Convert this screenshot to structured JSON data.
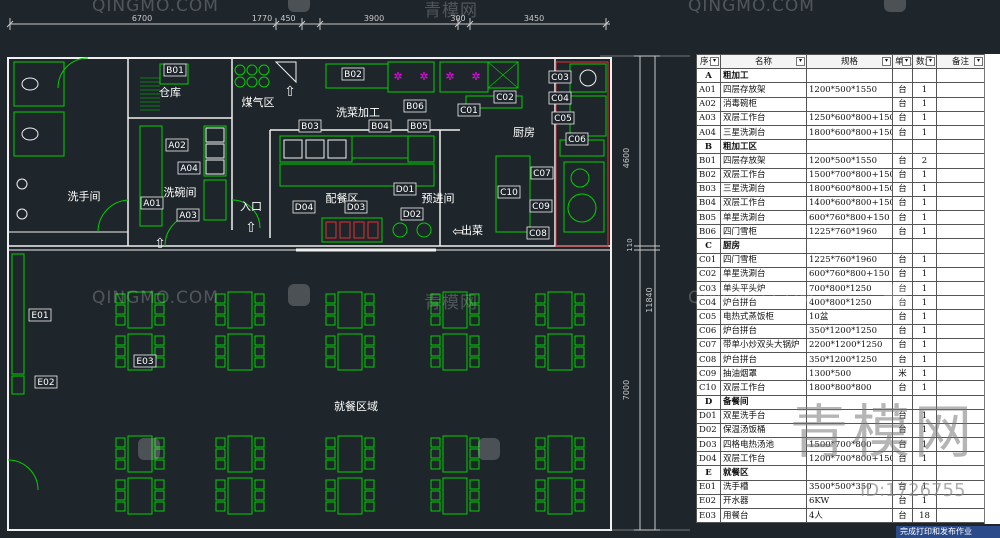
{
  "dimensions": {
    "top": [
      "6700",
      "1770",
      "450",
      "3900",
      "300",
      "3450"
    ],
    "right": [
      "4600",
      "110",
      "11840",
      "7000"
    ]
  },
  "rooms": {
    "storage": "仓库",
    "gas": "煤气区",
    "wash_veg": "洗菜加工",
    "kitchen": "厨房",
    "washroom": "洗手间",
    "dish": "洗碗间",
    "entrance": "入口",
    "serving": "配餐区",
    "pre_entry": "预进间",
    "dining": "就餐区域",
    "out": "出菜"
  },
  "tags": [
    "B01",
    "B02",
    "B03",
    "B04",
    "B05",
    "B06",
    "C01",
    "C02",
    "C03",
    "C04",
    "C05",
    "C06",
    "C07",
    "C08",
    "C09",
    "C10",
    "A01",
    "A02",
    "A03",
    "A04",
    "D01",
    "D02",
    "D03",
    "D04",
    "E01",
    "E02",
    "E03"
  ],
  "table": {
    "headers": [
      "序号",
      "名称",
      "规格",
      "单位",
      "数量",
      "备注"
    ],
    "rows": [
      {
        "c": [
          "A",
          "粗加工",
          "",
          "",
          "",
          ""
        ],
        "sec": true
      },
      {
        "c": [
          "A01",
          "四层存放架",
          "1200*500*1550",
          "台",
          "1",
          ""
        ]
      },
      {
        "c": [
          "A02",
          "消毒碗柜",
          "",
          "台",
          "1",
          ""
        ]
      },
      {
        "c": [
          "A03",
          "双层工作台",
          "1250*600*800+150",
          "台",
          "1",
          ""
        ]
      },
      {
        "c": [
          "A04",
          "三星洗涮台",
          "1800*600*800+150",
          "台",
          "1",
          ""
        ]
      },
      {
        "c": [
          "B",
          "粗加工区",
          "",
          "",
          "",
          ""
        ],
        "sec": true
      },
      {
        "c": [
          "B01",
          "四层存放架",
          "1200*500*1550",
          "台",
          "2",
          ""
        ]
      },
      {
        "c": [
          "B02",
          "双层工作台",
          "1500*700*800+150",
          "台",
          "1",
          ""
        ]
      },
      {
        "c": [
          "B03",
          "三星洗涮台",
          "1800*600*800+150",
          "台",
          "1",
          ""
        ]
      },
      {
        "c": [
          "B04",
          "双层工作台",
          "1400*600*800+150",
          "台",
          "1",
          ""
        ]
      },
      {
        "c": [
          "B05",
          "单星洗涮台",
          "600*760*800+150",
          "台",
          "1",
          ""
        ]
      },
      {
        "c": [
          "B06",
          "四门雪柜",
          "1225*760*1960",
          "台",
          "1",
          ""
        ]
      },
      {
        "c": [
          "C",
          "厨房",
          "",
          "",
          "",
          ""
        ],
        "sec": true
      },
      {
        "c": [
          "C01",
          "四门雪柜",
          "1225*760*1960",
          "台",
          "1",
          ""
        ]
      },
      {
        "c": [
          "C02",
          "单星洗涮台",
          "600*760*800+150",
          "台",
          "1",
          ""
        ]
      },
      {
        "c": [
          "C03",
          "单头平头炉",
          "700*800*1250",
          "台",
          "1",
          ""
        ]
      },
      {
        "c": [
          "C04",
          "炉台拼台",
          "400*800*1250",
          "台",
          "1",
          ""
        ]
      },
      {
        "c": [
          "C05",
          "电热式蒸饭柜",
          "10盆",
          "台",
          "1",
          ""
        ]
      },
      {
        "c": [
          "C06",
          "炉台拼台",
          "350*1200*1250",
          "台",
          "1",
          ""
        ]
      },
      {
        "c": [
          "C07",
          "带单小炒双头大锅炉",
          "2200*1200*1250",
          "台",
          "1",
          ""
        ]
      },
      {
        "c": [
          "C08",
          "炉台拼台",
          "350*1200*1250",
          "台",
          "1",
          ""
        ]
      },
      {
        "c": [
          "C09",
          "抽油烟罩",
          "1300*500",
          "米",
          "1",
          ""
        ]
      },
      {
        "c": [
          "C10",
          "双层工作台",
          "1800*800*800",
          "台",
          "1",
          ""
        ]
      },
      {
        "c": [
          "D",
          "备餐间",
          "",
          "",
          "",
          ""
        ],
        "sec": true
      },
      {
        "c": [
          "D01",
          "双星洗手台",
          "",
          "台",
          "1",
          ""
        ]
      },
      {
        "c": [
          "D02",
          "保温汤饭桶",
          "",
          "台",
          "1",
          ""
        ]
      },
      {
        "c": [
          "D03",
          "四格电热汤池",
          "1500*700*800",
          "台",
          "1",
          ""
        ]
      },
      {
        "c": [
          "D04",
          "双层工作台",
          "1200*700*800+150",
          "台",
          "1",
          ""
        ]
      },
      {
        "c": [
          "E",
          "就餐区",
          "",
          "",
          "",
          ""
        ],
        "sec": true
      },
      {
        "c": [
          "E01",
          "洗手槽",
          "3500*500*350",
          "台",
          "1",
          ""
        ]
      },
      {
        "c": [
          "E02",
          "开水器",
          "6KW",
          "台",
          "1",
          ""
        ]
      },
      {
        "c": [
          "E03",
          "用餐台",
          "4人",
          "台",
          "18",
          ""
        ]
      }
    ]
  },
  "watermarks": {
    "brand": "QINGMO.COM",
    "brand_cn": "青模网",
    "big": "青模网",
    "id": "ID:1726755"
  },
  "status_text": "完成打印和发布作业",
  "colors": {
    "bg": "#1f262b",
    "line": "#00d000",
    "wall": "#f0f0f0",
    "dim": "#c8c8c8",
    "text": "#ffffff",
    "magenta": "#ff00ff",
    "red": "#e03030"
  }
}
